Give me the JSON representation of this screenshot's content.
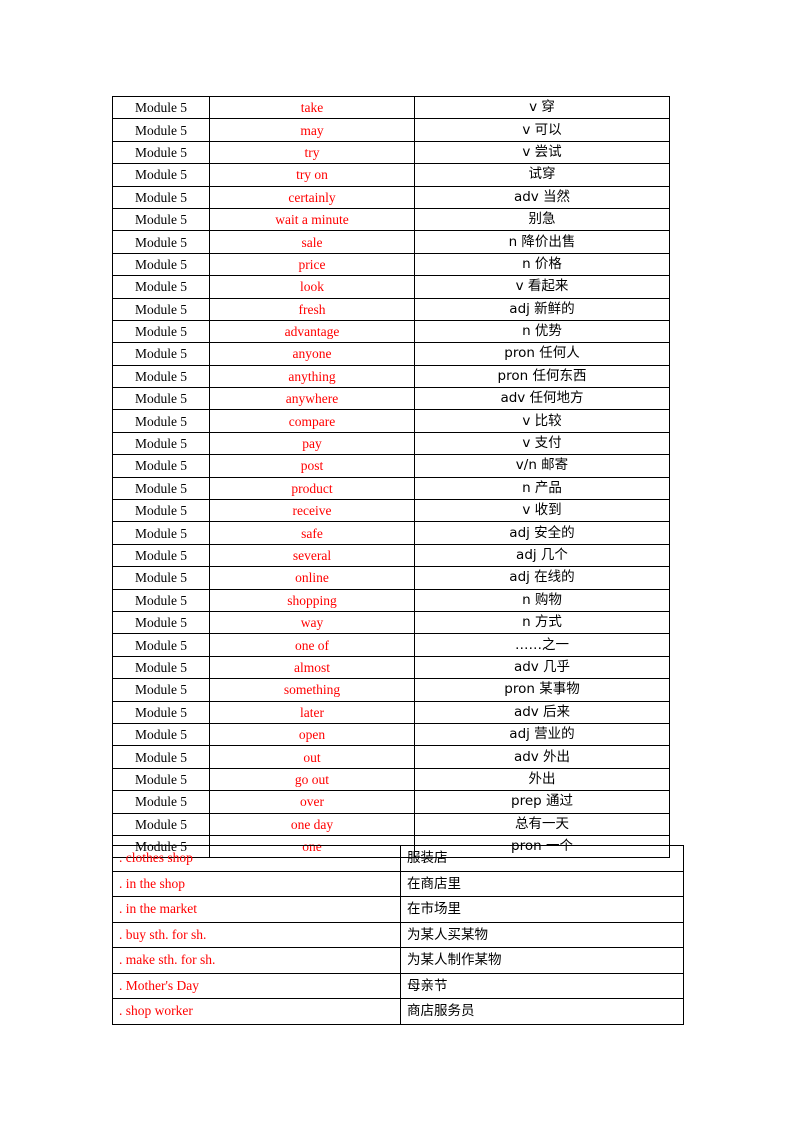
{
  "vocab_table": {
    "rows": [
      {
        "module": "Module 5",
        "word": "take",
        "meaning": "v 穿"
      },
      {
        "module": "Module 5",
        "word": "may",
        "meaning": "v 可以"
      },
      {
        "module": "Module 5",
        "word": "try",
        "meaning": "v 尝试"
      },
      {
        "module": "Module 5",
        "word": "try on",
        "meaning": "试穿"
      },
      {
        "module": "Module 5",
        "word": "certainly",
        "meaning": "adv 当然"
      },
      {
        "module": "Module 5",
        "word": "wait a minute",
        "meaning": "别急"
      },
      {
        "module": "Module 5",
        "word": "sale",
        "meaning": "n 降价出售"
      },
      {
        "module": "Module 5",
        "word": "price",
        "meaning": "n 价格"
      },
      {
        "module": "Module 5",
        "word": "look",
        "meaning": "v 看起来"
      },
      {
        "module": "Module 5",
        "word": "fresh",
        "meaning": "adj 新鲜的"
      },
      {
        "module": "Module 5",
        "word": "advantage",
        "meaning": "n 优势"
      },
      {
        "module": "Module 5",
        "word": "anyone",
        "meaning": "pron 任何人"
      },
      {
        "module": "Module 5",
        "word": "anything",
        "meaning": "pron 任何东西"
      },
      {
        "module": "Module 5",
        "word": "anywhere",
        "meaning": "adv 任何地方"
      },
      {
        "module": "Module 5",
        "word": "compare",
        "meaning": "v 比较"
      },
      {
        "module": "Module 5",
        "word": "pay",
        "meaning": "v 支付"
      },
      {
        "module": "Module 5",
        "word": "post",
        "meaning": "v/n 邮寄"
      },
      {
        "module": "Module 5",
        "word": "product",
        "meaning": "n 产品"
      },
      {
        "module": "Module 5",
        "word": "receive",
        "meaning": "v 收到"
      },
      {
        "module": "Module 5",
        "word": "safe",
        "meaning": "adj 安全的"
      },
      {
        "module": "Module 5",
        "word": "several",
        "meaning": "adj 几个"
      },
      {
        "module": "Module 5",
        "word": "online",
        "meaning": "adj 在线的"
      },
      {
        "module": "Module 5",
        "word": "shopping",
        "meaning": "n 购物"
      },
      {
        "module": "Module 5",
        "word": "way",
        "meaning": "n 方式"
      },
      {
        "module": "Module 5",
        "word": "one of",
        "meaning": "……之一"
      },
      {
        "module": "Module 5",
        "word": "almost",
        "meaning": "adv 几乎"
      },
      {
        "module": "Module 5",
        "word": "something",
        "meaning": "pron 某事物"
      },
      {
        "module": "Module 5",
        "word": "later",
        "meaning": "adv 后来"
      },
      {
        "module": "Module 5",
        "word": "open",
        "meaning": "adj 营业的"
      },
      {
        "module": "Module 5",
        "word": "out",
        "meaning": "adv 外出"
      },
      {
        "module": "Module 5",
        "word": "go out",
        "meaning": "外出"
      },
      {
        "module": "Module 5",
        "word": "over",
        "meaning": "prep 通过"
      },
      {
        "module": "Module 5",
        "word": "one day",
        "meaning": "总有一天"
      },
      {
        "module": "Module 5",
        "word": "one",
        "meaning": "pron 一个"
      }
    ]
  },
  "phrase_table": {
    "rows": [
      {
        "phrase": ". clothes shop",
        "meaning": "服装店"
      },
      {
        "phrase": ". in the shop",
        "meaning": "在商店里"
      },
      {
        "phrase": ". in the market",
        "meaning": "在市场里"
      },
      {
        "phrase": ". buy sth. for sh.",
        "meaning": "为某人买某物"
      },
      {
        "phrase": ". make sth. for sh.",
        "meaning": "为某人制作某物"
      },
      {
        "phrase": ". Mother's Day",
        "meaning": "母亲节"
      },
      {
        "phrase": ". shop worker",
        "meaning": "商店服务员"
      }
    ]
  },
  "colors": {
    "word_red": "#ff0000",
    "text_black": "#000000",
    "border": "#000000"
  }
}
